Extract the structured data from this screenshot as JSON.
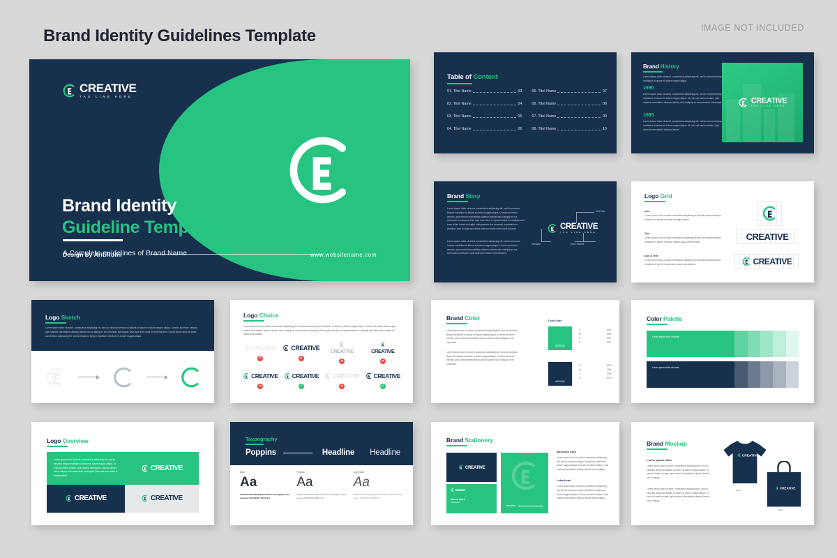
{
  "header": {
    "title": "Brand Identity Guidelines Template",
    "note": "IMAGE NOT INCLUDED"
  },
  "brand": {
    "name": "CREATIVE",
    "tagline": "TAG LINE HERE",
    "green": "#27c481",
    "navy": "#17304d"
  },
  "hero": {
    "title_line1": "Brand Identity",
    "title_line2": "Guideline Template",
    "subtitle": "A Complete guidelines of Brand Name",
    "credit": "Design by Arif Rumi",
    "website": "www.websitename.com"
  },
  "toc": {
    "title_a": "Table of ",
    "title_b": "Content",
    "left": [
      {
        "label": "01. Titel Name",
        "page": "03"
      },
      {
        "label": "02. Titel Name",
        "page": "04"
      },
      {
        "label": "03. Titel Name",
        "page": "05"
      },
      {
        "label": "04. Titel Name",
        "page": "06"
      }
    ],
    "right": [
      {
        "label": "05. Titel Name",
        "page": "07"
      },
      {
        "label": "06. Titel Name",
        "page": "08"
      },
      {
        "label": "07. Titel Name",
        "page": "09"
      },
      {
        "label": "08. Titel Name",
        "page": "10"
      }
    ]
  },
  "history": {
    "title_a": "Brand ",
    "title_b": "History",
    "intro": "Lorem ipsum dolor sit amet, consectetur adipiscing elit, sed do eiusmod tempor incididunt ut labore et dolore magna aliqua.",
    "year1": "1990",
    "body1": "Lorem ipsum dolor sit amet, consectetur adipiscing elit, sed do eiusmod tempor incididunt ut labore et dolore magna aliqua. Ut enim ad minim veniam, quis nostrud exercitation ullamco laboris nisi ut aliquip ex ea commodo consequat.",
    "year2": "1995",
    "body2": "Lorem ipsum dolor sit amet, consectetur adipiscing elit, sed do eiusmod tempor incididunt ut labore et dolore magna aliqua. Ut enim ad minim veniam, quis nostrud exercitation ullamco laboris."
  },
  "story": {
    "title_a": "Brand ",
    "title_b": "Story",
    "body1": "Lorem ipsum dolor sit amet, consectetur adipiscing elit, sed do eiusmod tempor incididunt ut labore et dolore magna aliqua. Ut enim ad minim veniam, quis nostrud exercitation ullamco laboris nisi ut aliquip ex ea commodo consequat. Duis aute irure dolor in reprehenderit in voluptate velit esse cillum dolore eu fugiat nulla pariatur sint occaecat cupidatat non proident, sunt in culpa qui officia deserunt mollit anim id est laborum.",
    "body2": "Lorem ipsum dolor sit amet, consectetur adipiscing elit, sed do eiusmod tempor incididunt ut labore et dolore magna aliqua. Ut enim ad minim veniam, quis nostrud exercitation ullamco laboris nisi ut aliquip ex ea commodo consequat. Quis aute irure dolore reprehenderit.",
    "labels": {
      "top_right": "Text Kind",
      "bottom_left": "Template",
      "bottom_right": "Mixel Tempelt"
    }
  },
  "logo_grid": {
    "title_a": "Logo ",
    "title_b": "Grid",
    "rows": [
      {
        "label": "Icon",
        "body": "Lorem ipsum dolor sit amet consectetur adipiscing elit sed do eiusmod tempor incididunt ut labore et dolore et magna aliqua."
      },
      {
        "label": "Text",
        "body": "Lorem ipsum dolor sit amet consectetur adipiscing elit sed do eiusmod tempor incididunt ut labore et dolore magna aliqua amet veniam."
      },
      {
        "label": "Icon & Text",
        "body": "Lorem ipsum dolor sit amet consectetur adipiscing elit sed do eiusmod tempor incididunt ut minim veniam quis nostrud exercitation."
      }
    ]
  },
  "sketch": {
    "title_a": "Logo ",
    "title_b": "Sketch",
    "body": "Lorem ipsum dolor sit amet, consectetur adipiscing elit, sed do eiusmod tempor incididunt ut labore et dolore magna aliqua. Ut enim ad minim veniam, quis nostrud exercitation ullamco laboris nisi ut aliquip ex ea commodo consequat. Duis aute irure dolor in reprehenderit. Lorem ipsum dolor sit amet, consectetur adipiscing elit, sed do eiusmod tempor incididunt ut labore et dolore magna aliqua."
  },
  "choice": {
    "title_a": "Logo ",
    "title_b": "Choice",
    "body": "Lorem ipsum dolor sit amet, consectetur adipiscing elit, sed do eiusmod tempor incididunt ut labore et dolore magna aliqua. Ut enim ad minim veniam, quis nostrud exercitation ullamco laboris nisi ut aliquip ex ea commodo consequat. Duis aute irure dolor in reprehenderit in voluptate velit esse cillum dolore eu fugiat nulla pariatur.",
    "marks": [
      "no",
      "no",
      "no",
      "no",
      "no",
      "yes",
      "no",
      "yes"
    ]
  },
  "brand_color": {
    "title_a": "Brand ",
    "title_b": "Color",
    "body1": "Lorem ipsum dolor sit amet, consectetur adipiscing elit, sed do eiusmod tempor incididunt ut labore et dolore magna aliqua. Ut enim ad minim veniam, quis nostrud exercitation ullamco laboris nisi ut aliquip ex ea commodo.",
    "body2": "Lorem ipsum dolor sit amet, consectetur adipiscing elit, sed do eiusmod tempor incididunt ut labore et dolore magna aliqua. Ut enim ad minim veniam, quis nostrud exercitation ullamco laboris nisi ut aliquip ex ea commodo.",
    "code_label": "Color Code",
    "swatches": [
      {
        "hex_label": "#000000",
        "color": "#27c481",
        "cmyk": [
          {
            "key": "C",
            "value": "60%"
          },
          {
            "key": "M",
            "value": "00%"
          },
          {
            "key": "Y",
            "value": "57%"
          },
          {
            "key": "K",
            "value": "00%"
          }
        ]
      },
      {
        "hex_label": "#000000",
        "color": "#17304d",
        "cmyk": [
          {
            "key": "C",
            "value": "60%"
          },
          {
            "key": "M",
            "value": "39%"
          },
          {
            "key": "Y",
            "value": "10%"
          },
          {
            "key": "K",
            "value": "67%"
          }
        ]
      }
    ]
  },
  "palette": {
    "title_a": "Color ",
    "title_b": "Palette",
    "rows": [
      {
        "label": "Lorem ipsum dolor sit amet",
        "main": "#27c481",
        "tints": [
          "#5fd3a1",
          "#7fdcb4",
          "#9fe5c7",
          "#bfeeda",
          "#dff7ec"
        ]
      },
      {
        "label": "Lorem ipsum dolor sit amet",
        "main": "#17304d",
        "tints": [
          "#475a72",
          "#6b7a8e",
          "#8d99a8",
          "#a9b3bf",
          "#ccd3da"
        ]
      }
    ]
  },
  "overview": {
    "title_a": "Logo ",
    "title_b": "Overview",
    "body": "Lorem ipsum dolor sit amet, consectetur adipiscing elit, sed do eiusmod tempor incididunt ut labore et dolore magna aliqua. Ut enim ad minim veniam, quis nostrud exercitation ullamco laboris nisi ut aliquip ex ea commodo consequat. Duis aute irure dolor in reprehenderit."
  },
  "typography": {
    "title": "Taypography",
    "font_name": "Poppins",
    "headline_bold": "Headline",
    "headline_light": "Headline",
    "weights": [
      {
        "label": "Bold",
        "sample": "Aa",
        "charset": "ABCDEFGHIJKLMNOPQRSTUVWXYZ abcdefghijklmnopqrstuvwxyz 0123456789 !@#$%^&*()~"
      },
      {
        "label": "Regular",
        "sample": "Aa",
        "charset": "ABCDEFGHIJKLMNOPQRSTUVWXYZ abcdefghijklmnopqrstuvwxyz 0123456789 !@#$%^&*()~"
      },
      {
        "label": "Light Italic",
        "sample": "Aa",
        "charset": "ABCDEFGHIJKLMNOPQRSTUVWXYZ abcdefghijklmnopqrstuvwxyz 0123456789 !@#$%^&*()~"
      }
    ]
  },
  "stationery": {
    "title_a": "Brand ",
    "title_b": "Stationery",
    "card_name": "Name Here",
    "card_role": "Designation",
    "sections": [
      {
        "heading": "Business Card",
        "body": "Lorem ipsum dolor sit amet, consectetur adipiscing elit, sed do eiusmod tempor incididunt ut labore et dolore magna aliqua. Ut enim ad minim veniam, quis nostrud exercitation ullamco laboris nisi ut aliquip."
      },
      {
        "heading": "Letterhead",
        "body": "Lorem ipsum dolor sit amet, consectetur adipiscing elit, sed do eiusmod tempor incididunt ut labore et dolore magna aliqua. Ut enim ad minim veniam, quis nostrud exercitation ullamco laboris nisi ut aliquip."
      }
    ]
  },
  "mockup": {
    "title_a": "Brand ",
    "title_b": "Mockup",
    "subheading": "Lorem ipsum dolor",
    "body1": "Lorem ipsum dolor sit amet, consectetur adipiscing elit, sed do eiusmod tempor incididunt ut labore et dolore magna aliqua. Ut enim ad minim veniam, quis nostrud exercitation ullamco laboris nisi ut aliquip.",
    "body2": "Lorem ipsum dolor sit amet, consectetur adipiscing elit, sed do eiusmod tempor incididunt ut labore et dolore magna aliqua. Ut enim ad minim veniam, quis nostrud exercitation ullamco laboris nisi ut aliquip.",
    "caption_tshirt": "Tshirt",
    "caption_bag": "Bag"
  }
}
